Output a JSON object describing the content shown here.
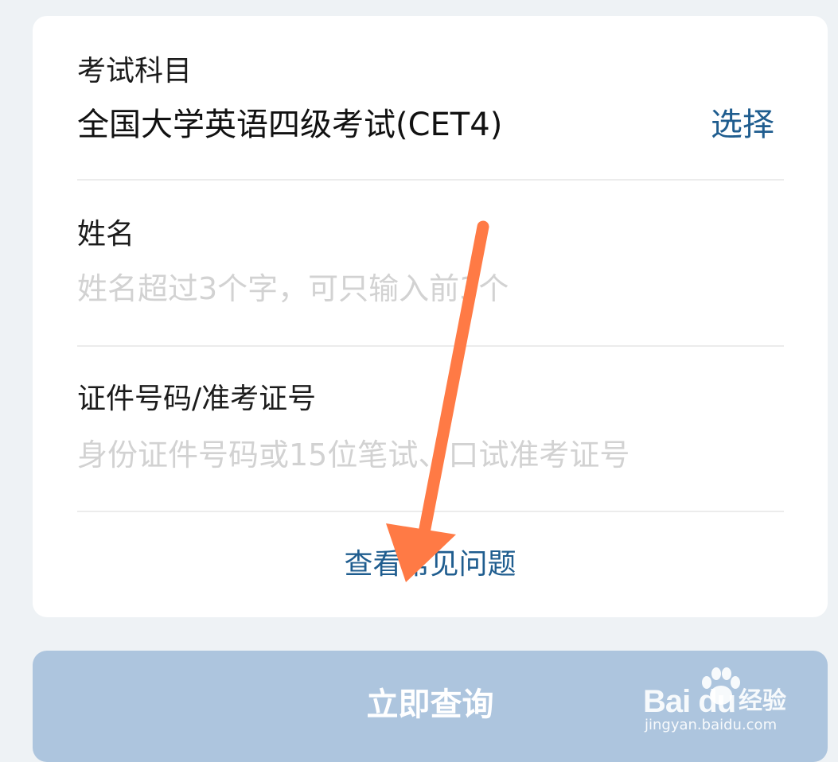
{
  "form": {
    "subject": {
      "label": "考试科目",
      "value": "全国大学英语四级考试(CET4)",
      "select_label": "选择"
    },
    "name": {
      "label": "姓名",
      "placeholder": "姓名超过3个字，可只输入前3个"
    },
    "id_number": {
      "label": "证件号码/准考证号",
      "placeholder": "身份证件号码或15位笔试、口试准考证号"
    },
    "faq_link": "查看常见问题"
  },
  "submit": {
    "label": "立即查询"
  },
  "annotation": {
    "arrow_color": "#ff7a45"
  },
  "watermark": {
    "brand": "Bai du",
    "brand_cn": "经验",
    "url": "jingyan.baidu.com"
  },
  "colors": {
    "page_background": "#eef2f5",
    "link": "#1f5d8f",
    "button": "#adc5de",
    "placeholder": "#d2d2d2"
  }
}
